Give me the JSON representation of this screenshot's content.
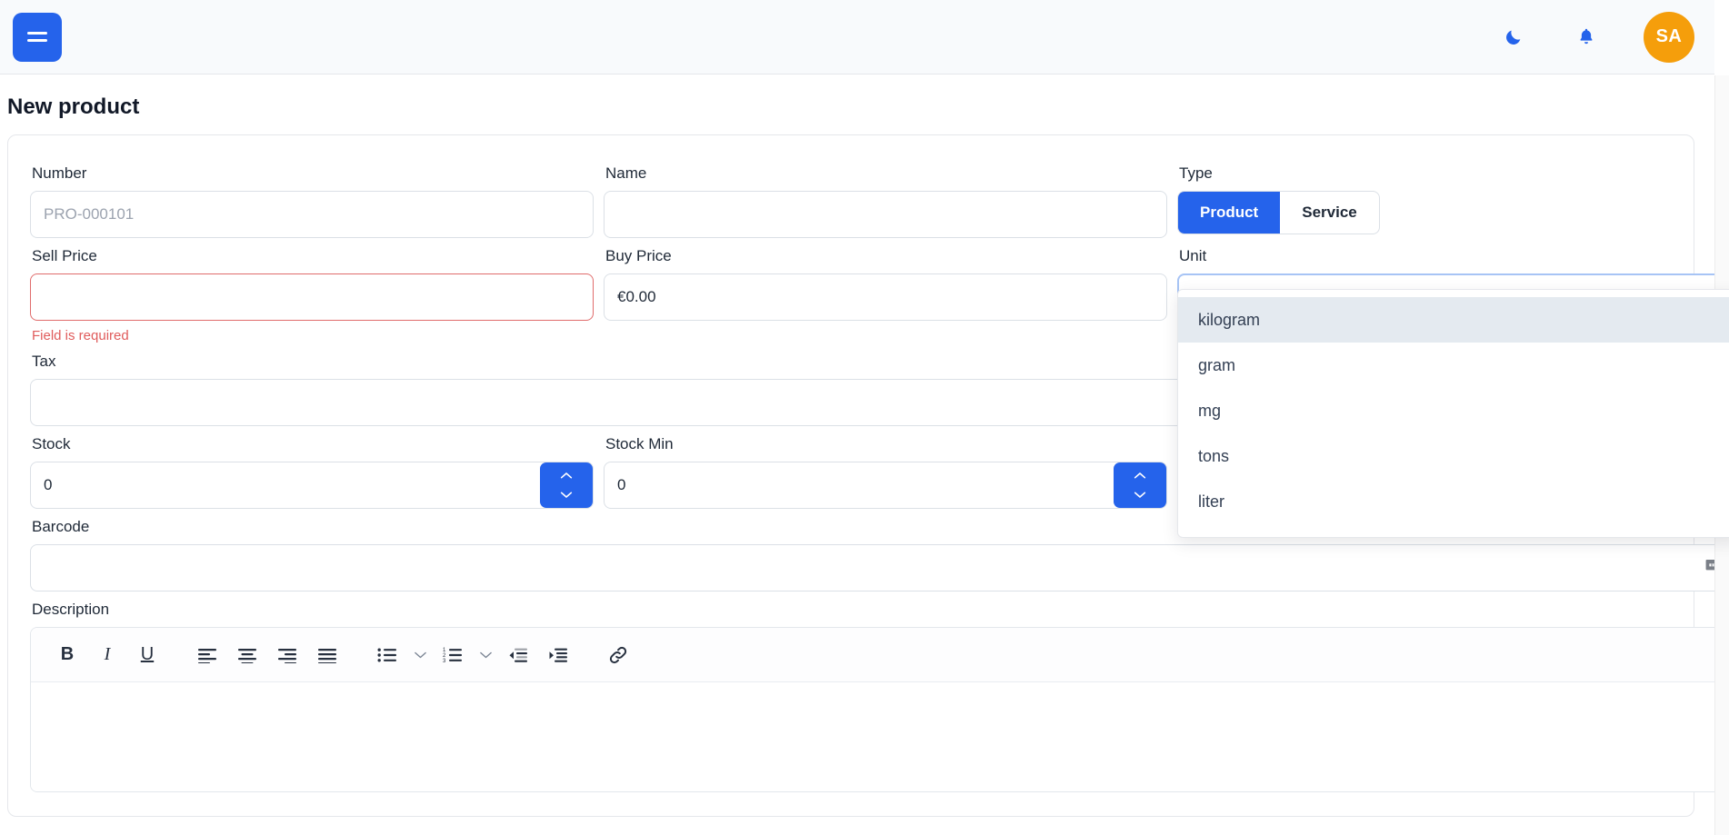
{
  "topbar": {
    "menu_icon": "hamburger-icon",
    "dark_mode_icon": "moon-icon",
    "notifications_icon": "bell-icon",
    "avatar_initials": "SA",
    "avatar_color": "#f59e0b",
    "accent_color": "#2563eb"
  },
  "page": {
    "title": "New product"
  },
  "form": {
    "number": {
      "label": "Number",
      "value": "",
      "placeholder": "PRO-000101"
    },
    "name": {
      "label": "Name",
      "value": "",
      "placeholder": ""
    },
    "type": {
      "label": "Type",
      "options": [
        "Product",
        "Service"
      ],
      "selected": "Product"
    },
    "sell_price": {
      "label": "Sell Price",
      "value": "",
      "placeholder": "",
      "error": "Field is required"
    },
    "buy_price": {
      "label": "Buy Price",
      "value": "€0.00",
      "placeholder": ""
    },
    "unit": {
      "label": "Unit",
      "value": "",
      "placeholder": "",
      "expanded": true,
      "highlighted_option": "kilogram",
      "options": [
        "kilogram",
        "gram",
        "mg",
        "tons",
        "liter"
      ],
      "chevron_icon": "chevron-down-icon"
    },
    "tax": {
      "label": "Tax",
      "value": "",
      "placeholder": ""
    },
    "stock": {
      "label": "Stock",
      "value": "0",
      "placeholder": ""
    },
    "stock_min": {
      "label": "Stock Min",
      "value": "0",
      "placeholder": ""
    },
    "barcode": {
      "label": "Barcode",
      "value": "",
      "placeholder": "",
      "icon": "barcode-scan-tooltip-icon"
    },
    "description": {
      "label": "Description",
      "value": ""
    }
  },
  "editor_toolbar": {
    "bold": "B",
    "italic": "I",
    "underline": "U",
    "buttons": [
      "bold-button",
      "italic-button",
      "underline-button",
      "align-left-button",
      "align-center-button",
      "align-right-button",
      "align-justify-button",
      "bulleted-list-button",
      "bulleted-list-options-button",
      "numbered-list-button",
      "numbered-list-options-button",
      "outdent-button",
      "indent-button",
      "link-button"
    ]
  }
}
